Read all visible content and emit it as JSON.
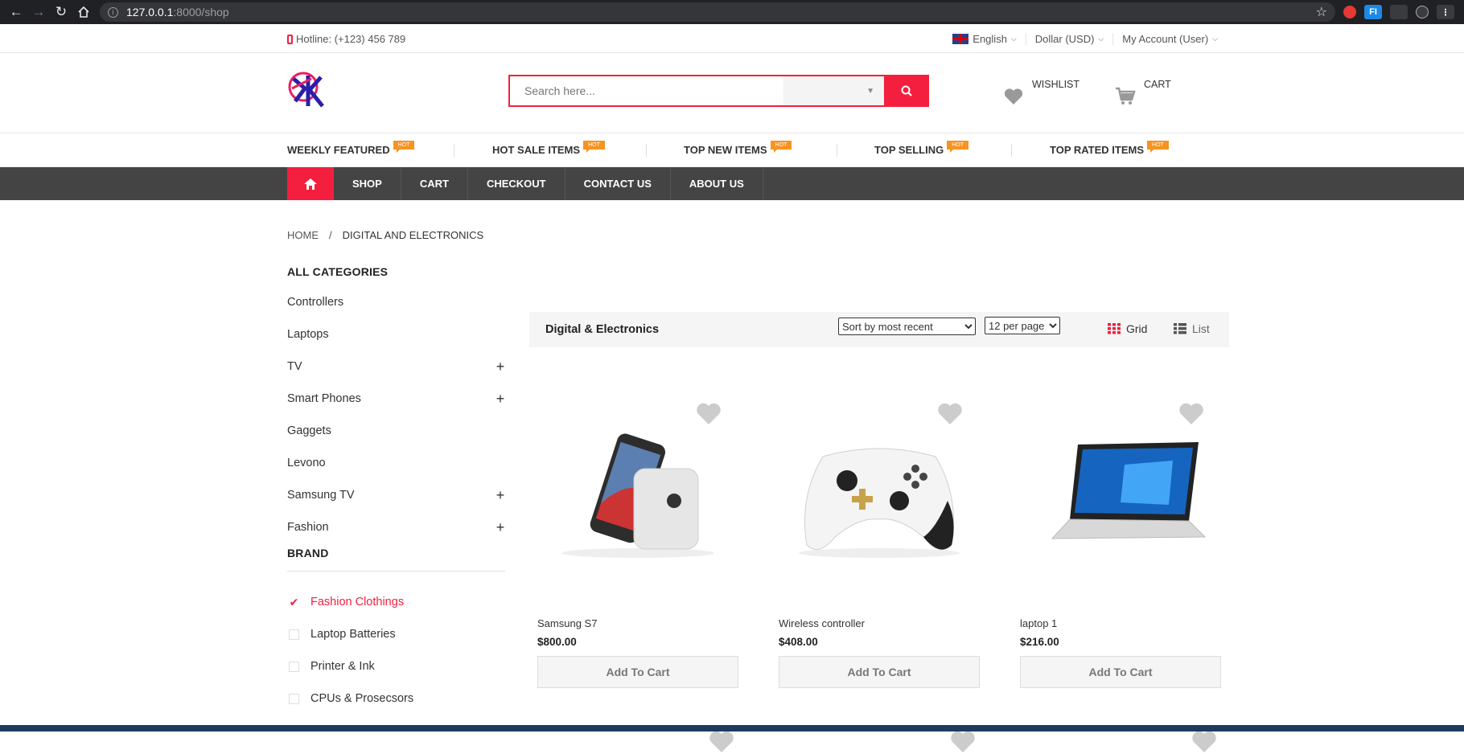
{
  "browser": {
    "url_host": "127.0.0.1",
    "url_path": ":8000/shop"
  },
  "topbar": {
    "hotline": "Hotline: (+123) 456 789",
    "language": "English",
    "currency": "Dollar (USD)",
    "account": "My Account (User)"
  },
  "header": {
    "search_placeholder": "Search here...",
    "wishlist_label": "WISHLIST",
    "cart_label": "CART"
  },
  "hotbar": {
    "badge": "HOT",
    "items": [
      {
        "label": "WEEKLY FEATURED"
      },
      {
        "label": "HOT SALE ITEMS"
      },
      {
        "label": "TOP NEW ITEMS"
      },
      {
        "label": "TOP SELLING"
      },
      {
        "label": "TOP RATED ITEMS"
      }
    ]
  },
  "mainnav": {
    "items": [
      {
        "label": "SHOP"
      },
      {
        "label": "CART"
      },
      {
        "label": "CHECKOUT"
      },
      {
        "label": "CONTACT US"
      },
      {
        "label": "ABOUT US"
      }
    ]
  },
  "breadcrumb": {
    "home": "HOME",
    "separator": "/",
    "current": "DIGITAL AND ELECTRONICS"
  },
  "sidebar": {
    "categories_title": "ALL CATEGORIES",
    "categories": [
      {
        "label": "Controllers",
        "expandable": false
      },
      {
        "label": "Laptops",
        "expandable": false
      },
      {
        "label": "TV",
        "expandable": true
      },
      {
        "label": "Smart Phones",
        "expandable": true
      },
      {
        "label": "Gaggets",
        "expandable": false
      },
      {
        "label": "Levono",
        "expandable": false
      },
      {
        "label": "Samsung TV",
        "expandable": true
      },
      {
        "label": "Fashion",
        "expandable": true
      }
    ],
    "brand_title": "BRAND",
    "brands": [
      {
        "label": "Fashion Clothings",
        "checked": true
      },
      {
        "label": "Laptop Batteries",
        "checked": false
      },
      {
        "label": "Printer & Ink",
        "checked": false
      },
      {
        "label": "CPUs & Prosecsors",
        "checked": false
      }
    ]
  },
  "toolbar": {
    "title": "Digital & Electronics",
    "sort_selected": "Sort by most recent",
    "per_page_selected": "12 per page",
    "grid_label": "Grid",
    "list_label": "List"
  },
  "products": [
    {
      "name": "Samsung S7",
      "price": "$800.00",
      "button": "Add To Cart",
      "image": "smartphone"
    },
    {
      "name": "Wireless controller",
      "price": "$408.00",
      "button": "Add To Cart",
      "image": "game-controller"
    },
    {
      "name": "laptop 1",
      "price": "$216.00",
      "button": "Add To Cart",
      "image": "laptop"
    }
  ],
  "colors": {
    "accent": "#f41f3e",
    "nav_bg": "#444444",
    "hot_badge": "#f79321"
  }
}
